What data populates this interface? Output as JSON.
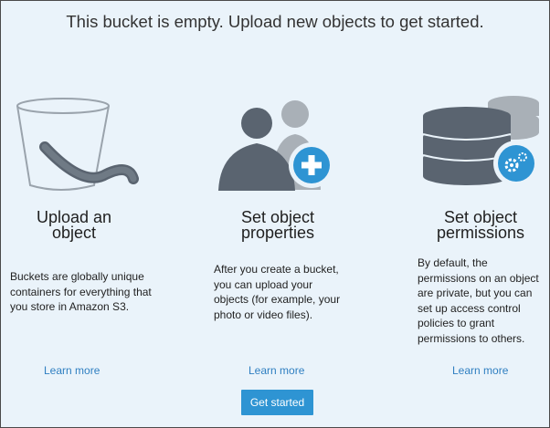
{
  "headline": "This bucket is empty. Upload new objects to get started.",
  "columns": [
    {
      "title_line1": "Upload an",
      "title_line2": "object",
      "description": "Buckets are globally unique containers for everything that you store in Amazon S3.",
      "link": "Learn more",
      "icon": "bucket-icon"
    },
    {
      "title_line1": "Set object",
      "title_line2": "properties",
      "description": "After you create a bucket, you can upload your objects (for example, your photo or video files).",
      "link": "Learn more",
      "icon": "user-add-icon"
    },
    {
      "title_line1": "Set object",
      "title_line2": "permissions",
      "description": "By default, the permissions on an object are private, but you can set up access control policies to grant permissions to others.",
      "link": "Learn more",
      "icon": "database-settings-icon"
    }
  ],
  "get_started_label": "Get started",
  "colors": {
    "background": "#eaf3fa",
    "accent": "#2e94d3",
    "link": "#2f7fc1",
    "icon_dark": "#5a6470",
    "icon_light": "#a9b0b7"
  }
}
